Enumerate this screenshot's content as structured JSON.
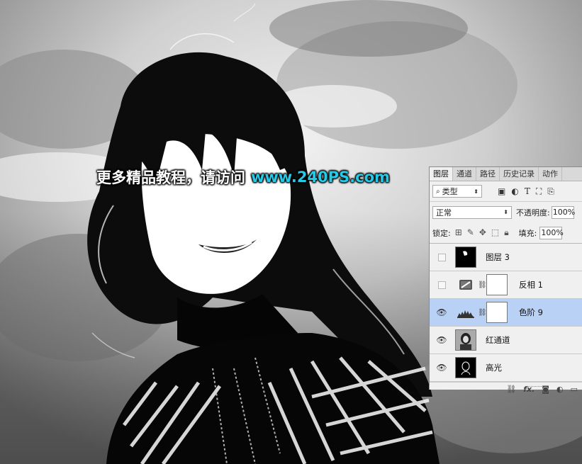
{
  "watermark": {
    "chinese": "更多精品教程，请访问",
    "url": "www.240PS.com",
    "url_color": "#26c9e6"
  },
  "panel": {
    "tabs": [
      "图层",
      "通道",
      "路径",
      "历史记录",
      "动作"
    ],
    "active_tab": "图层",
    "filter": {
      "label": "类型",
      "icon": "search-icon",
      "filter_icons": [
        "image-filter-icon",
        "adjustment-filter-icon",
        "type-filter-icon",
        "shape-filter-icon",
        "smart-object-filter-icon"
      ]
    },
    "blend_mode": "正常",
    "opacity_label": "不透明度:",
    "opacity_value": "100%",
    "lock_label": "锁定:",
    "fill_label": "填充:",
    "fill_value": "100%",
    "layers": [
      {
        "name": "图层 3",
        "visible": false,
        "selected": false,
        "thumb": "dark-brush",
        "has_mask": false
      },
      {
        "name": "反相 1",
        "visible": false,
        "selected": false,
        "thumb": "invert-adjustment",
        "has_mask": true
      },
      {
        "name": "色阶 9",
        "visible": true,
        "selected": true,
        "thumb": "levels-adjustment",
        "has_mask": true
      },
      {
        "name": "红通道",
        "visible": true,
        "selected": false,
        "thumb": "portrait-photo",
        "has_mask": false
      },
      {
        "name": "高光",
        "visible": true,
        "selected": false,
        "thumb": "dark-portrait",
        "has_mask": false
      }
    ],
    "footer_icons": [
      "link-icon",
      "fx-icon",
      "add-mask-icon",
      "adjustment-icon",
      "new-group-icon"
    ],
    "footer_fx": "fx."
  }
}
